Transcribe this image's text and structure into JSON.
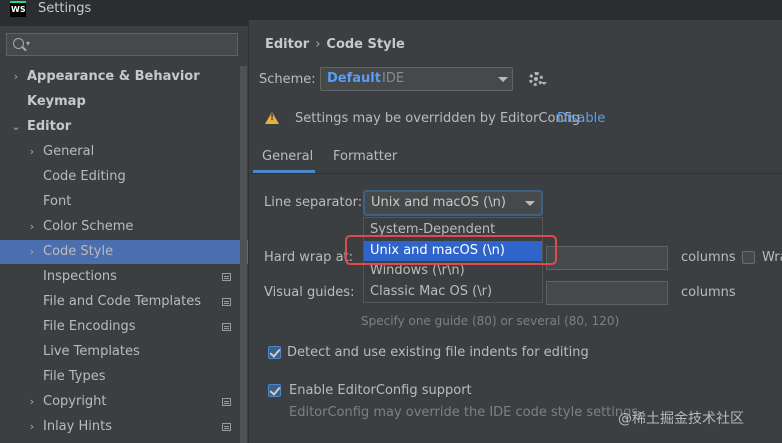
{
  "window": {
    "title": "Settings",
    "logo_text": "WS"
  },
  "sidebar": {
    "search_placeholder": "",
    "items": [
      {
        "label": "Appearance & Behavior",
        "bold": true,
        "arrow": "›",
        "level": 0
      },
      {
        "label": "Keymap",
        "bold": true,
        "arrow": "",
        "level": 0
      },
      {
        "label": "Editor",
        "bold": true,
        "arrow": "⌄",
        "level": 0
      },
      {
        "label": "General",
        "arrow": "›",
        "level": 1
      },
      {
        "label": "Code Editing",
        "arrow": "",
        "level": 1
      },
      {
        "label": "Font",
        "arrow": "",
        "level": 1
      },
      {
        "label": "Color Scheme",
        "arrow": "›",
        "level": 1
      },
      {
        "label": "Code Style",
        "arrow": "›",
        "level": 1,
        "selected": true
      },
      {
        "label": "Inspections",
        "arrow": "",
        "level": 1,
        "badge": true
      },
      {
        "label": "File and Code Templates",
        "arrow": "",
        "level": 1,
        "badge": true
      },
      {
        "label": "File Encodings",
        "arrow": "",
        "level": 1,
        "badge": true
      },
      {
        "label": "Live Templates",
        "arrow": "",
        "level": 1
      },
      {
        "label": "File Types",
        "arrow": "",
        "level": 1
      },
      {
        "label": "Copyright",
        "arrow": "›",
        "level": 1,
        "badge": true
      },
      {
        "label": "Inlay Hints",
        "arrow": "›",
        "level": 1,
        "badge": true
      }
    ]
  },
  "breadcrumb": {
    "parent": "Editor",
    "separator": "›",
    "current": "Code Style"
  },
  "scheme": {
    "label": "Scheme:",
    "value": "Default",
    "scope": "IDE"
  },
  "warning": {
    "text": "Settings may be overridden by EditorConfig",
    "link": "Disable"
  },
  "tabs": [
    {
      "label": "General",
      "active": true
    },
    {
      "label": "Formatter"
    }
  ],
  "form": {
    "line_separator_label": "Line separator:",
    "line_separator_value": "Unix and macOS (\\n)",
    "hard_wrap_label": "Hard wrap at:",
    "hard_wrap_unit": "columns",
    "wrap_checkbox_label": "Wra",
    "visual_guides_label": "Visual guides:",
    "visual_guides_unit": "columns",
    "visual_guides_hint": "Specify one guide (80) or several (80, 120)",
    "detect_indents_label": "Detect and use existing file indents for editing",
    "detect_indents_checked": true,
    "editorconfig_label": "Enable EditorConfig support",
    "editorconfig_checked": true,
    "editorconfig_hint": "EditorConfig may override the IDE code style settings"
  },
  "dropdown_options": [
    {
      "label": "System-Dependent"
    },
    {
      "label": "Unix and macOS (\\n)",
      "highlighted": true
    },
    {
      "label": "Windows (\\r\\n)"
    },
    {
      "label": "Classic Mac OS (\\r)"
    }
  ],
  "watermark": "@稀土掘金技术社区",
  "colors": {
    "accent": "#4b6eaf",
    "link": "#589df6",
    "highlight_outline": "#e04a4a",
    "warning": "#e2b23c"
  }
}
